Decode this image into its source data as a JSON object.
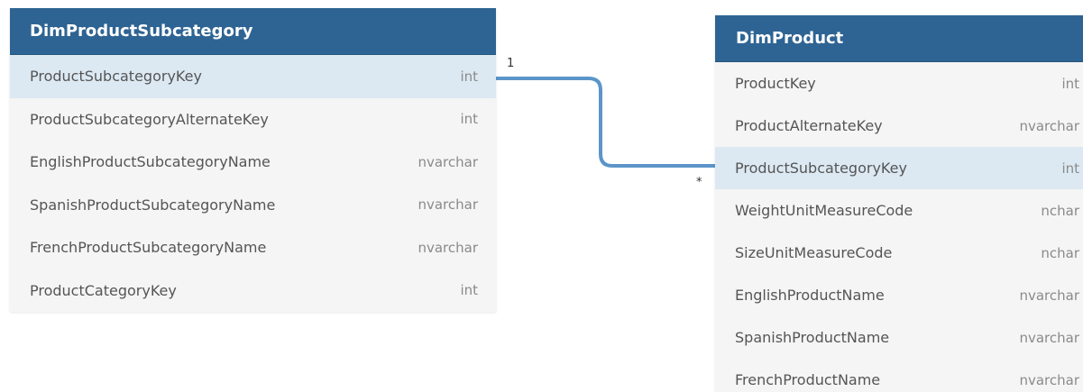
{
  "tables": [
    {
      "name": "DimProductSubcategory",
      "columns": [
        {
          "name": "ProductSubcategoryKey",
          "type": "int",
          "highlight": true
        },
        {
          "name": "ProductSubcategoryAlternateKey",
          "type": "int"
        },
        {
          "name": "EnglishProductSubcategoryName",
          "type": "nvarchar"
        },
        {
          "name": "SpanishProductSubcategoryName",
          "type": "nvarchar"
        },
        {
          "name": "FrenchProductSubcategoryName",
          "type": "nvarchar"
        },
        {
          "name": "ProductCategoryKey",
          "type": "int"
        }
      ]
    },
    {
      "name": "DimProduct",
      "columns": [
        {
          "name": "ProductKey",
          "type": "int"
        },
        {
          "name": "ProductAlternateKey",
          "type": "nvarchar"
        },
        {
          "name": "ProductSubcategoryKey",
          "type": "int",
          "highlight": true
        },
        {
          "name": "WeightUnitMeasureCode",
          "type": "nchar"
        },
        {
          "name": "SizeUnitMeasureCode",
          "type": "nchar"
        },
        {
          "name": "EnglishProductName",
          "type": "nvarchar"
        },
        {
          "name": "SpanishProductName",
          "type": "nvarchar"
        },
        {
          "name": "FrenchProductName",
          "type": "nvarchar"
        }
      ]
    }
  ],
  "relationship": {
    "from_table": "DimProductSubcategory",
    "from_column": "ProductSubcategoryKey",
    "to_table": "DimProduct",
    "to_column": "ProductSubcategoryKey",
    "from_cardinality": "1",
    "to_cardinality": "*"
  },
  "colors": {
    "header": "#2e6493",
    "highlight_row": "#dce9f3",
    "connector": "#5b95c9"
  }
}
